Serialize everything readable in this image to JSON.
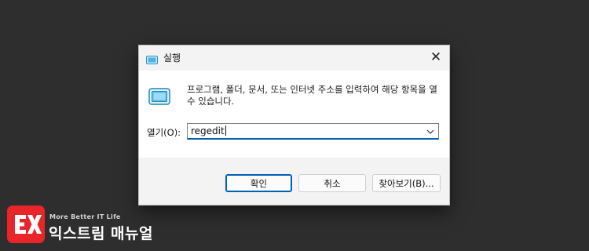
{
  "dialog": {
    "title": "실행",
    "close_glyph": "✕",
    "description": "프로그램, 폴더, 문서, 또는 인터넷 주소를 입력하여 해당 항목을 열 수 있습니다.",
    "open_label": "열기(O):",
    "open_value": "regedit",
    "buttons": {
      "ok": "확인",
      "cancel": "취소",
      "browse": "찾아보기(B)..."
    },
    "icons": {
      "title": "run-app-icon",
      "body": "run-app-icon",
      "close": "close-icon",
      "dropdown": "chevron-down-icon"
    }
  },
  "watermark": {
    "tagline": "More Better IT Life",
    "brand": "익스트림 매뉴얼",
    "icon": "brand-logo-icon"
  },
  "colors": {
    "background": "#2e2e2e",
    "accent": "#005fb8",
    "logo": "#e8262a"
  }
}
